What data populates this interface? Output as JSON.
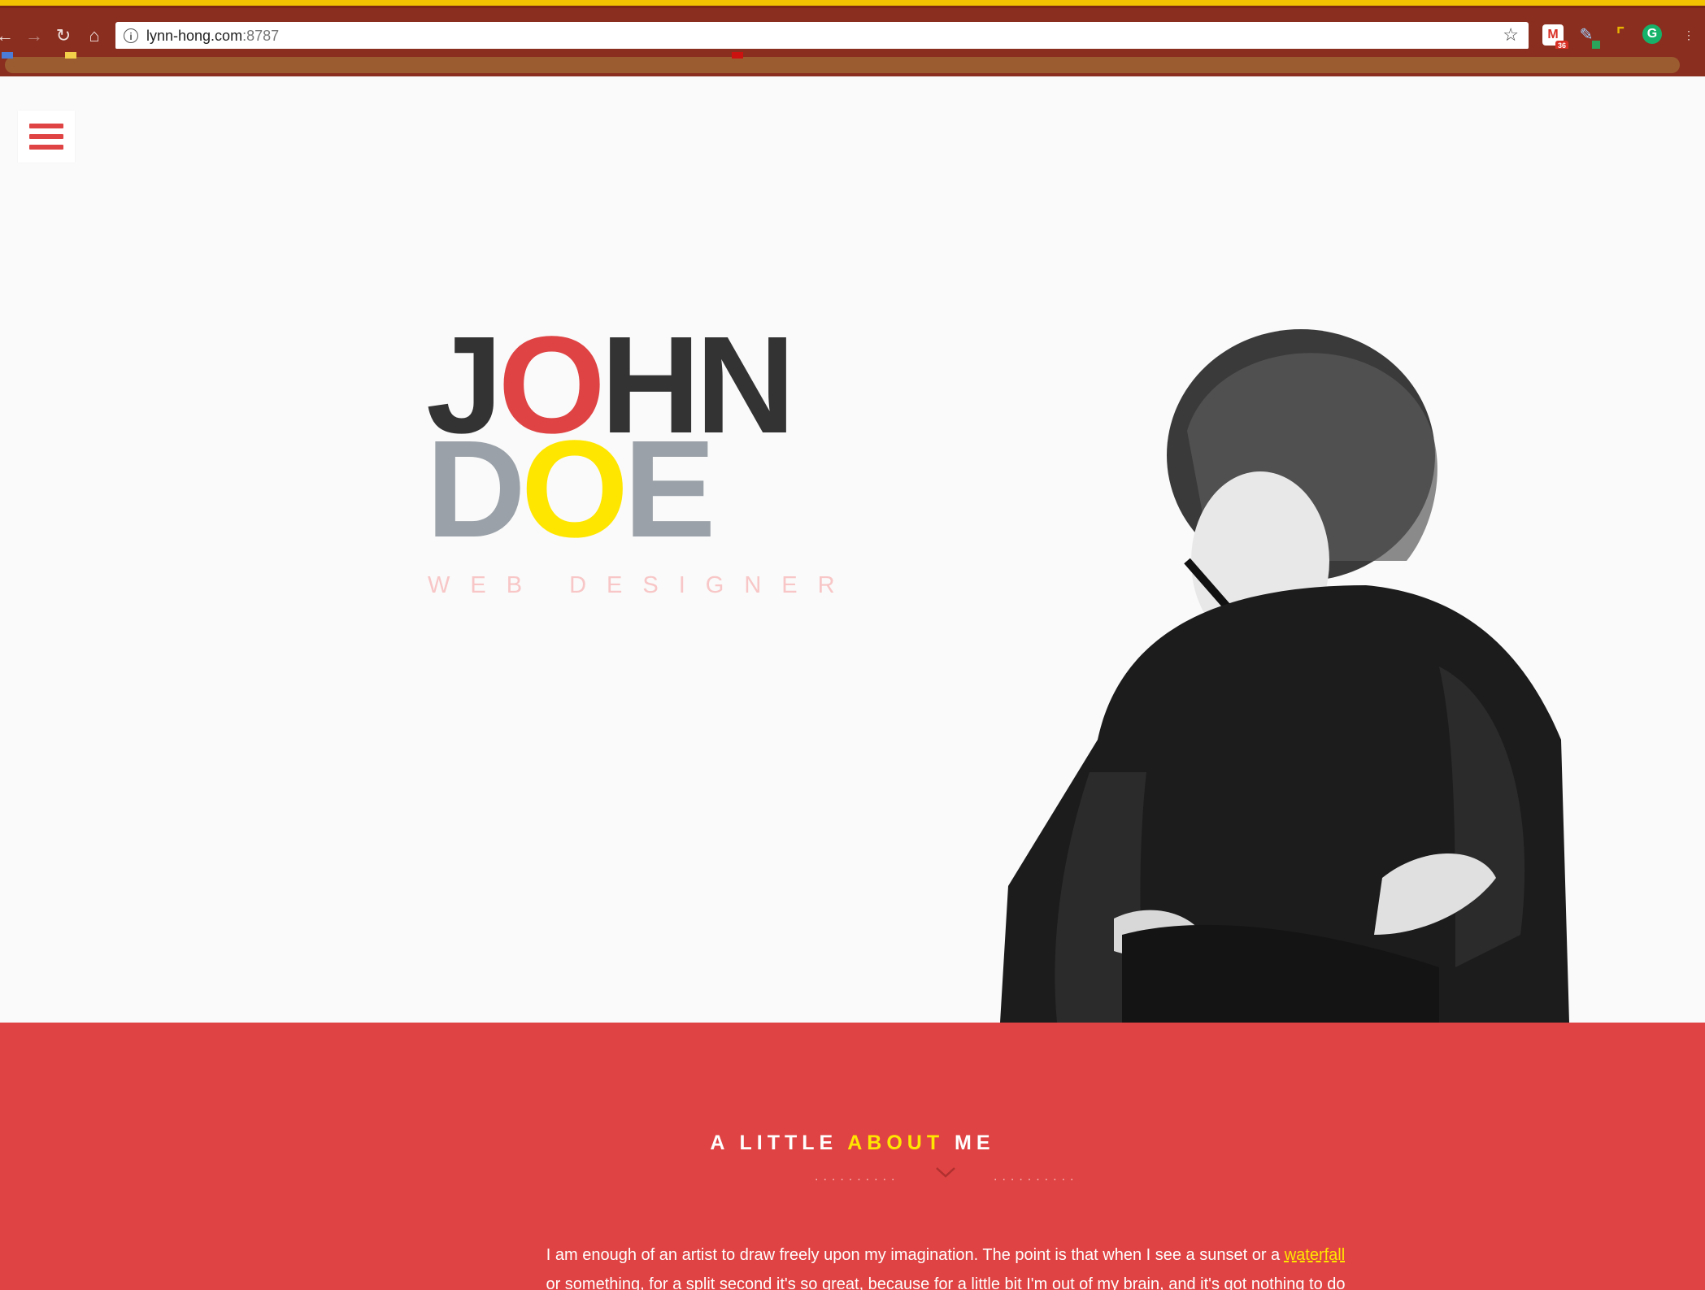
{
  "browser": {
    "url_host": "lynn-hong.com",
    "url_port": ":8787",
    "info_icon": "info-icon",
    "star_icon": "bookmark-star-icon",
    "extensions": {
      "mail_badge": "36"
    }
  },
  "nav": {
    "menu_icon": "hamburger-menu-icon"
  },
  "hero": {
    "first_name_parts": [
      "J",
      "O",
      "HN"
    ],
    "last_name_parts": [
      "D",
      "O",
      "E"
    ],
    "subtitle": "WEB DESIGNER",
    "portrait": "black-and-white-portrait-photo"
  },
  "about": {
    "title_before": "A LITTLE ",
    "title_highlight": "ABOUT",
    "title_after": " ME",
    "dots_left": "..........",
    "dots_right": "..........",
    "text_before": "I am enough of an artist to draw freely upon my imagination. The point is that when I see a sunset or a ",
    "text_link": "waterfall",
    "text_after": " or something, for a split second it's so great, because for a little bit I'm out of my brain, and it's got nothing to do with"
  },
  "colors": {
    "accent_red": "#e04343",
    "accent_yellow": "#ffe600",
    "dark": "#333333",
    "gray": "#9aa1a8",
    "page_bg": "#fafafa"
  }
}
